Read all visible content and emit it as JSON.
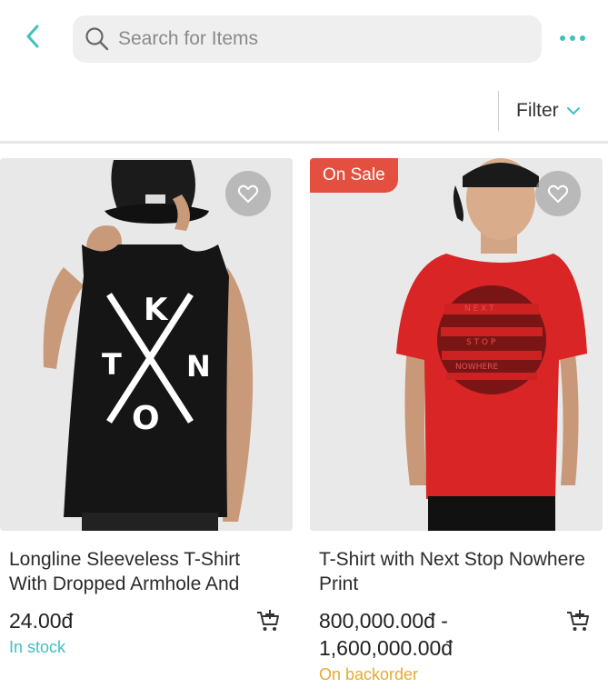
{
  "search": {
    "placeholder": "Search for Items"
  },
  "filter": {
    "label": "Filter"
  },
  "colors": {
    "accent": "#3fc1c1",
    "sale": "#e4503f",
    "backorder": "#e8a930"
  },
  "icons": {
    "back": "chevron-left-icon",
    "search": "search-icon",
    "more": "more-dots-icon",
    "filter": "chevron-down-icon",
    "wishlist": "heart-icon",
    "cart": "add-to-cart-icon"
  },
  "products": [
    {
      "name": "Longline Sleeveless T-Shirt With Dropped Armhole And",
      "price": "24.00đ",
      "stock": "In stock",
      "badge": ""
    },
    {
      "name": "T-Shirt with Next Stop Nowhere Print",
      "price": "800,000.00đ - 1,600,000.00đ",
      "stock": "On backorder",
      "badge": "On Sale"
    }
  ]
}
